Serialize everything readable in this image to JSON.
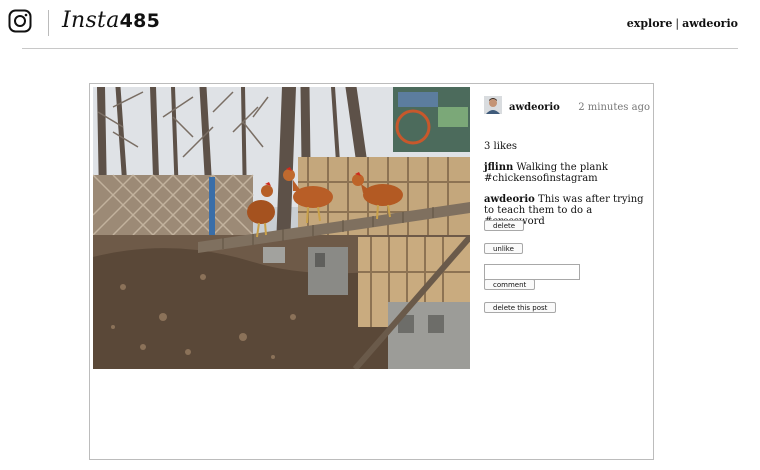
{
  "header": {
    "logo_text": "Insta",
    "logo_number": "485",
    "nav_explore": "explore",
    "nav_separator": "|",
    "nav_user": "awdeorio"
  },
  "post": {
    "owner": "awdeorio",
    "timestamp": "2 minutes ago",
    "likes": "3 likes",
    "comments": [
      {
        "author": "jflinn",
        "text": "Walking the plank #chickensofinstagram"
      },
      {
        "author": "awdeorio",
        "text": "This was after trying to teach them to do a #crossword"
      }
    ],
    "delete_comment_label": "delete",
    "unlike_label": "unlike",
    "comment_input_value": "",
    "comment_button_label": "comment",
    "delete_post_label": "delete this post"
  },
  "icons": {
    "logo": "instagram-camera-icon"
  },
  "colors": {
    "text": "#111111",
    "timestamp": "#777777",
    "border": "#bcbcbc"
  }
}
